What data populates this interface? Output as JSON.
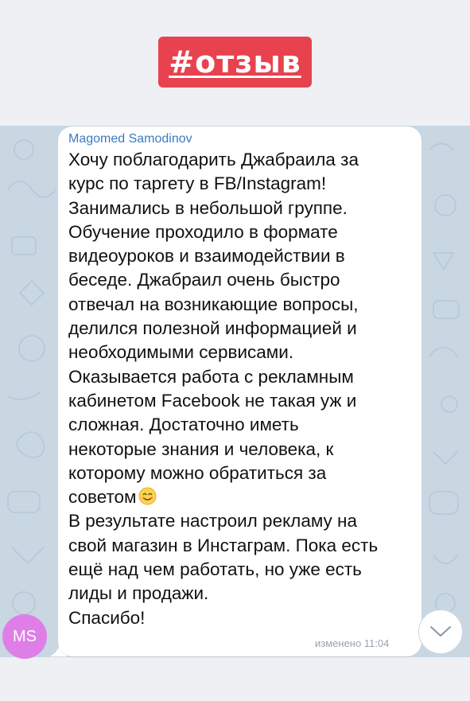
{
  "header": {
    "hashtag": "#отзыв",
    "badge_color": "#e8424f"
  },
  "message": {
    "sender": "Magomed Samodinov",
    "lines": [
      "Хочу поблагодарить Джабраила за",
      "курс по таргету в FB/Instagram!",
      "Занимались в небольшой группе.",
      "Обучение проходило в формате",
      "видеоуроков и взаимодействии в",
      "беседе. Джабраил очень быстро",
      "отвечал на возникающие вопросы,",
      "делился полезной информацией и",
      "необходимыми сервисами.",
      "Оказывается работа с рекламным",
      "кабинетом Facebook не такая уж и",
      "сложная. Достаточно иметь",
      "некоторые знания и человека, к",
      "которому можно обратиться за",
      "советом",
      "В результате настроил рекламу на",
      "свой магазин в Инстаграм. Пока есть",
      "ещё над чем работать, но уже есть",
      "лиды и продажи.",
      "Спасибо!"
    ],
    "emoji": "smiling-face-emoji",
    "edited_status": "изменено 11:04"
  },
  "avatar": {
    "initials": "MS",
    "color": "#e07ee8"
  },
  "icons": {
    "scroll_down": "chevron-down-icon"
  }
}
